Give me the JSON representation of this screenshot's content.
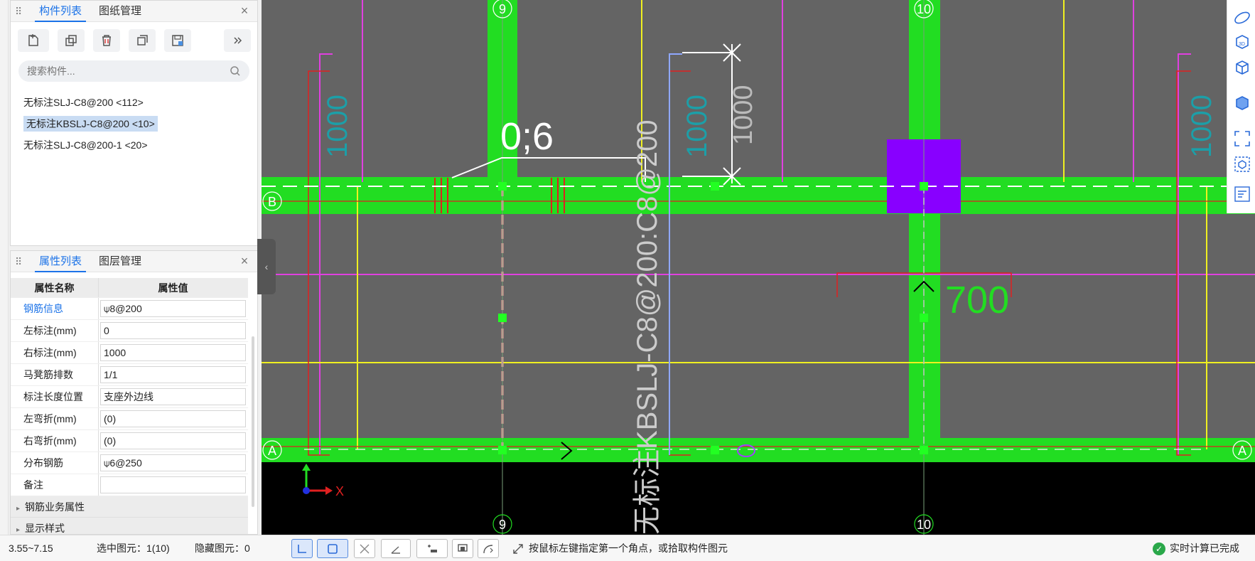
{
  "component_panel": {
    "tabs": [
      {
        "label": "构件列表",
        "active": true
      },
      {
        "label": "图纸管理",
        "active": false
      }
    ],
    "close": "×",
    "toolbar_icons": [
      "new-icon",
      "copy-icon",
      "delete-icon",
      "layer-copy-icon",
      "save-icon",
      "more-icon"
    ],
    "search": {
      "placeholder": "搜索构件..."
    },
    "items": [
      {
        "label": "无标注SLJ-C8@200 <112>",
        "selected": false
      },
      {
        "label": "无标注KBSLJ-C8@200 <10>",
        "selected": true
      },
      {
        "label": "无标注SLJ-C8@200-1 <20>",
        "selected": false
      }
    ]
  },
  "property_panel": {
    "tabs": [
      {
        "label": "属性列表",
        "active": true
      },
      {
        "label": "图层管理",
        "active": false
      }
    ],
    "close": "×",
    "header": {
      "name": "属性名称",
      "value": "属性值"
    },
    "rows": [
      {
        "name": "钢筋信息",
        "value": "⍦8@200",
        "link": true
      },
      {
        "name": "左标注(mm)",
        "value": "0"
      },
      {
        "name": "右标注(mm)",
        "value": "1000"
      },
      {
        "name": "马凳筋排数",
        "value": "1/1"
      },
      {
        "name": "标注长度位置",
        "value": "支座外边线"
      },
      {
        "name": "左弯折(mm)",
        "value": "(0)"
      },
      {
        "name": "右弯折(mm)",
        "value": "(0)"
      },
      {
        "name": "分布钢筋",
        "value": "⍦6@250"
      },
      {
        "name": "备注",
        "value": ""
      }
    ],
    "groups": [
      "钢筋业务属性",
      "显示样式"
    ]
  },
  "canvas": {
    "axis_labels": {
      "col9": "9",
      "col10": "10",
      "rowA": "A",
      "rowB": "B"
    },
    "annotations": {
      "span_label": "0;6",
      "dim_1000_vertical": "1000",
      "dim_1000_left": "1000",
      "dim_1000_mid": "1000",
      "dim_1000_right": "1000",
      "dim_700": "700",
      "rebar_label": "无标注KBSLJ-C8@200:C8@200",
      "x_axis": "X"
    },
    "colors": {
      "background": "#646464",
      "beam": "#22dd22",
      "magenta": "#e040e0",
      "yellow": "#f0f020",
      "red": "#e02020",
      "purple": "#8800ff",
      "black": "#000000"
    }
  },
  "right_tools": [
    "rotate-view-icon",
    "3d-view-icon",
    "cube-view-icon",
    "shaded-cube-icon",
    "fullscreen-icon",
    "component-view-icon",
    "display-settings-icon"
  ],
  "statusbar": {
    "coords": "3.55~7.15",
    "selected": "选中图元：1(10)",
    "hidden": "隐藏图元：0",
    "hint": "按鼠标左键指定第一个角点，或拾取构件图元",
    "status": "实时计算已完成"
  }
}
